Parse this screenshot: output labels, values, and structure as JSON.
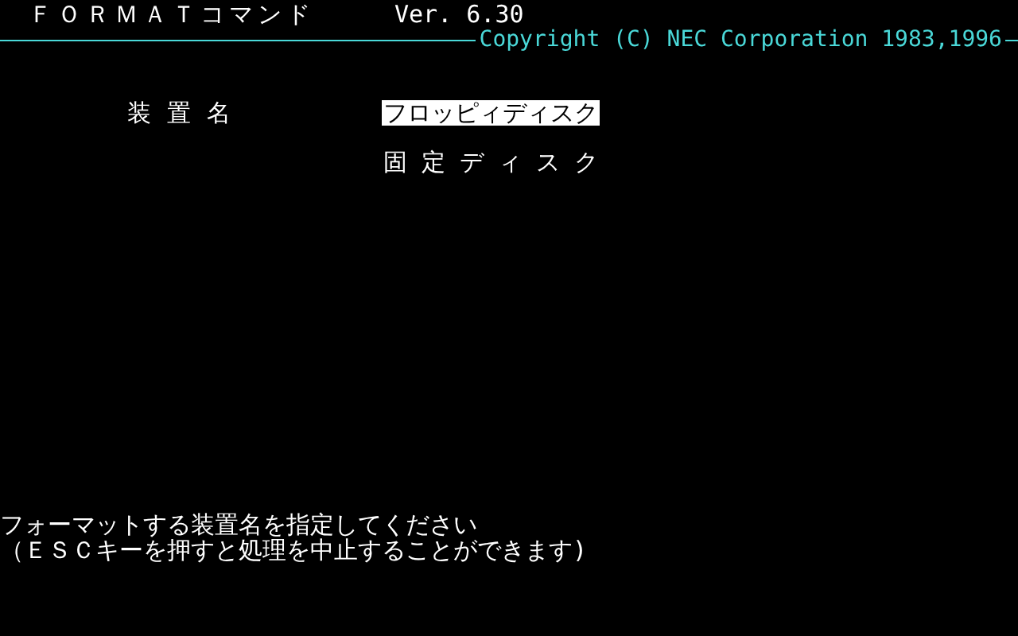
{
  "header": {
    "title": "ＦＯＲＭＡＴコマンド",
    "version": "Ver. 6.30",
    "copyright": "Copyright (C) NEC Corporation 1983,1996"
  },
  "device_menu": {
    "label": "装置名",
    "options": [
      {
        "label": "フロッピィディスク",
        "selected": true
      },
      {
        "label": "固定ディスク",
        "selected": false
      }
    ]
  },
  "message": {
    "lines": [
      "フォーマットする装置名を指定してください",
      "（ＥＳＣキーを押すと処理を中止することができます)"
    ]
  }
}
